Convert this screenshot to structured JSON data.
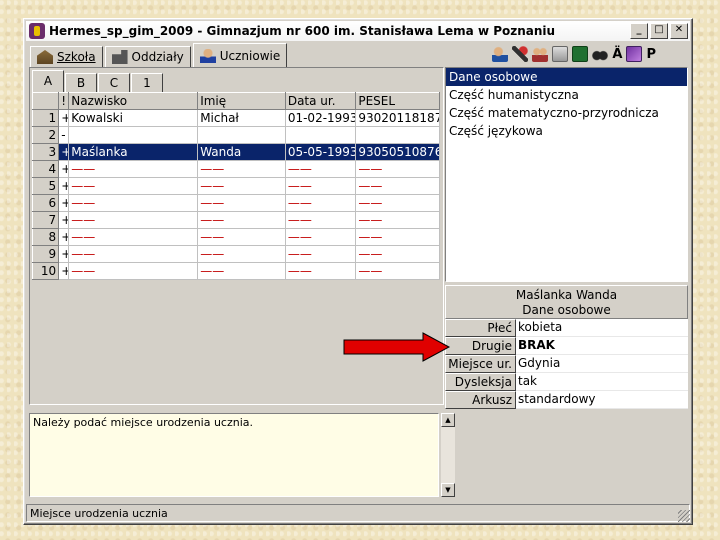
{
  "window": {
    "title": "Hermes_sp_gim_2009 - Gimnazjum nr 600 im. Stanisława Lema w Poznaniu",
    "controls": {
      "minimize": "_",
      "maximize": "□",
      "close": "✕"
    }
  },
  "tabs": [
    {
      "label": "Szkoła",
      "icon": "school-icon"
    },
    {
      "label": "Oddziały",
      "icon": "group-icon"
    },
    {
      "label": "Uczniowie",
      "icon": "student-icon",
      "active": true
    }
  ],
  "toolbar": {
    "label_a": "Ä",
    "label_p": "P"
  },
  "subtabs": [
    "A",
    "B",
    "C",
    "1"
  ],
  "grid": {
    "columns": [
      "!",
      "Nazwisko",
      "Imię",
      "Data ur.",
      "PESEL"
    ],
    "rows": [
      {
        "num": "1",
        "mark": "+",
        "surname": "Kowalski",
        "name": "Michał",
        "dob": "01-02-1993",
        "pesel": "93020118187"
      },
      {
        "num": "2",
        "mark": "-",
        "surname": "",
        "name": "",
        "dob": "",
        "pesel": ""
      },
      {
        "num": "3",
        "mark": "+",
        "surname": "Maślanka",
        "name": "Wanda",
        "dob": "05-05-1993",
        "pesel": "93050510876",
        "selected": true
      },
      {
        "num": "4",
        "mark": "+",
        "surname": "——",
        "name": "——",
        "dob": "——",
        "pesel": "——"
      },
      {
        "num": "5",
        "mark": "+",
        "surname": "——",
        "name": "——",
        "dob": "——",
        "pesel": "——"
      },
      {
        "num": "6",
        "mark": "+",
        "surname": "——",
        "name": "——",
        "dob": "——",
        "pesel": "——"
      },
      {
        "num": "7",
        "mark": "+",
        "surname": "——",
        "name": "——",
        "dob": "——",
        "pesel": "——"
      },
      {
        "num": "8",
        "mark": "+",
        "surname": "——",
        "name": "——",
        "dob": "——",
        "pesel": "——"
      },
      {
        "num": "9",
        "mark": "+",
        "surname": "——",
        "name": "——",
        "dob": "——",
        "pesel": "——"
      },
      {
        "num": "10",
        "mark": "+",
        "surname": "——",
        "name": "——",
        "dob": "——",
        "pesel": "——"
      }
    ]
  },
  "sections": [
    "Dane osobowe",
    "Część humanistyczna",
    "Część matematyczno-przyrodnicza",
    "Część językowa"
  ],
  "details": {
    "header_name": "Maślanka Wanda",
    "header_section": "Dane osobowe",
    "rows": [
      {
        "key": "Płeć",
        "value": "kobieta"
      },
      {
        "key": "Drugie imię",
        "value": "BRAK",
        "bold": true
      },
      {
        "key": "Miejsce ur.",
        "value": "Gdynia"
      },
      {
        "key": "Dysleksja",
        "value": "tak"
      },
      {
        "key": "Arkusz",
        "value": "standardowy"
      }
    ]
  },
  "message": "Należy podać miejsce urodzenia ucznia.",
  "status": "Miejsce urodzenia ucznia",
  "colors": {
    "selection": "#0a246a",
    "arrow": "#e00000",
    "placeholder": "#c00000"
  }
}
